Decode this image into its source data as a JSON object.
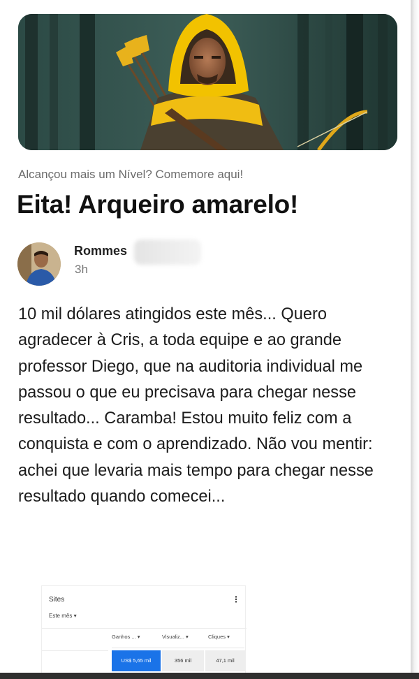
{
  "post": {
    "category": "Alcançou mais um Nível? Comemore aqui!",
    "title": "Eita! Arqueiro amarelo!",
    "author_name": "Rommes",
    "time_ago": "3h",
    "body": "10 mil dólares atingidos este mês... Quero agradecer à Cris, a toda equipe e ao grande professor Diego, que na auditoria individual me passou o que eu precisava para chegar nesse resultado... Caramba! Estou muito feliz com a conquista e com o aprendizado. Não vou mentir: achei que levaria mais tempo para chegar nesse resultado quando comecei..."
  },
  "earnings_card": {
    "title": "Sites",
    "period": "Este mês",
    "columns": {
      "earnings": "Ganhos ...",
      "views": "Visualiz...",
      "clicks": "Cliques"
    },
    "values": {
      "earnings": "US$ 5,65 mil",
      "views": "356 mil",
      "clicks": "47,1 mil"
    }
  },
  "icons": {
    "card_menu": "more-vert-icon",
    "dropdown": "caret-down-icon"
  },
  "colors": {
    "accent_blue": "#1a73e8",
    "hood_yellow": "#f2c200",
    "title_text": "#111111",
    "muted_text": "#6b6b6b"
  }
}
